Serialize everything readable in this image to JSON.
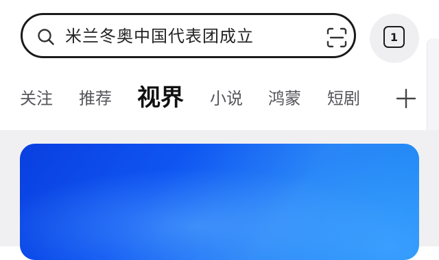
{
  "search": {
    "query": "米兰冬奥中国代表团成立"
  },
  "tabs_button": {
    "count": "1"
  },
  "nav": {
    "tabs": [
      {
        "label": "关注"
      },
      {
        "label": "推荐"
      },
      {
        "label": "视界"
      },
      {
        "label": "小说"
      },
      {
        "label": "鸿蒙"
      },
      {
        "label": "短剧"
      }
    ],
    "active_tab": "视界"
  },
  "icons": {
    "search": "search-icon",
    "scan": "scan-icon",
    "tabs": "tabs-icon",
    "add": "plus-icon"
  },
  "colors": {
    "banner_blue": "#0f55f2",
    "background_gray": "#f0f0f2",
    "active_text": "#111111"
  }
}
